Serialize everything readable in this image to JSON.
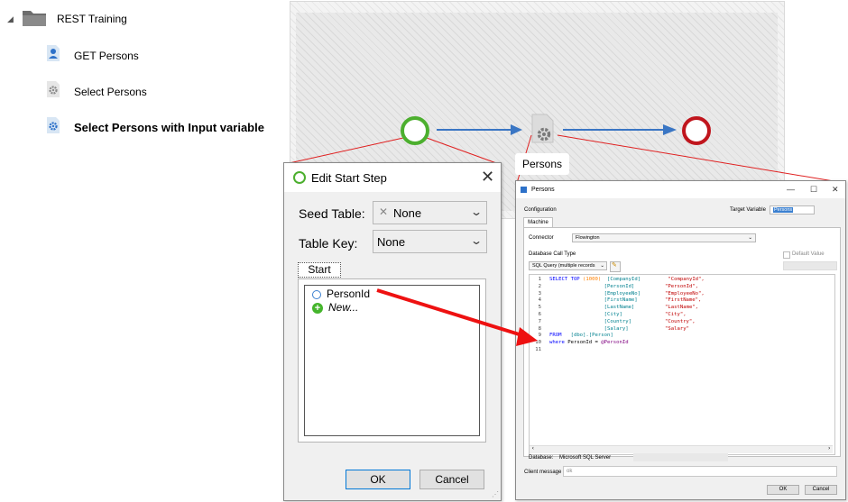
{
  "tree": {
    "root_label": "REST Training",
    "items": [
      {
        "label": "GET Persons",
        "icon": "person-icon"
      },
      {
        "label": "Select Persons",
        "icon": "gear-doc-icon"
      },
      {
        "label": "Select Persons with Input variable",
        "icon": "gear-blue-icon",
        "selected": true
      }
    ]
  },
  "canvas": {
    "step_label": "Persons",
    "colors": {
      "start": "#4caf2e",
      "end": "#c0151d",
      "arrow": "#3a76c4",
      "callout_line": "#e02020"
    }
  },
  "start_dialog": {
    "title": "Edit Start Step",
    "close": "✕",
    "seed_table_label": "Seed Table:",
    "seed_table_value": "None",
    "table_key_label": "Table Key:",
    "table_key_value": "None",
    "tab_label": "Start",
    "variables": [
      {
        "name": "PersonId"
      }
    ],
    "new_label": "New...",
    "ok": "OK",
    "cancel": "Cancel"
  },
  "persons_dialog": {
    "title": "Persons",
    "configuration_label": "Configuration",
    "target_variable_label": "Target Variable",
    "target_variable_value": "Persons",
    "machine_tab": "Machine",
    "connector_label": "Connector",
    "connector_value": "Flowington",
    "default_value_label": "Default Value",
    "db_call_type_label": "Database Call Type",
    "db_call_type_value": "SQL Query (multiple records",
    "code_lines": [
      {
        "n": "1",
        "t": [
          [
            "kw",
            "SELECT TOP "
          ],
          [
            "num",
            "(1000)"
          ],
          [
            "txt",
            "  "
          ],
          [
            "col",
            "[CompanyId]"
          ],
          [
            "txt",
            "         "
          ],
          [
            "str",
            "\"CompanyId\","
          ]
        ]
      },
      {
        "n": "2",
        "t": [
          [
            "txt",
            "                  "
          ],
          [
            "col",
            "[PersonId]"
          ],
          [
            "txt",
            "          "
          ],
          [
            "str",
            "\"PersonId\","
          ]
        ]
      },
      {
        "n": "3",
        "t": [
          [
            "txt",
            "                  "
          ],
          [
            "col",
            "[EmployeeNo]"
          ],
          [
            "txt",
            "        "
          ],
          [
            "str",
            "\"EmployeeNo\","
          ]
        ]
      },
      {
        "n": "4",
        "t": [
          [
            "txt",
            "                  "
          ],
          [
            "col",
            "[FirstName]"
          ],
          [
            "txt",
            "         "
          ],
          [
            "str",
            "\"FirstName\","
          ]
        ]
      },
      {
        "n": "5",
        "t": [
          [
            "txt",
            "                  "
          ],
          [
            "col",
            "[LastName]"
          ],
          [
            "txt",
            "          "
          ],
          [
            "str",
            "\"LastName\","
          ]
        ]
      },
      {
        "n": "6",
        "t": [
          [
            "txt",
            "                  "
          ],
          [
            "col",
            "[City]"
          ],
          [
            "txt",
            "              "
          ],
          [
            "str",
            "\"City\","
          ]
        ]
      },
      {
        "n": "7",
        "t": [
          [
            "txt",
            "                  "
          ],
          [
            "col",
            "[Country]"
          ],
          [
            "txt",
            "           "
          ],
          [
            "str",
            "\"Country\","
          ]
        ]
      },
      {
        "n": "8",
        "t": [
          [
            "txt",
            "                  "
          ],
          [
            "col",
            "[Salary]"
          ],
          [
            "txt",
            "            "
          ],
          [
            "str",
            "\"Salary\""
          ]
        ]
      },
      {
        "n": "9",
        "t": [
          [
            "kw",
            "FROM   "
          ],
          [
            "col",
            "[dbo].[Person]"
          ]
        ]
      },
      {
        "n": "10",
        "t": [
          [
            "kw",
            "where "
          ],
          [
            "txt",
            "PersonId = "
          ],
          [
            "vr",
            "@PersonId"
          ]
        ]
      },
      {
        "n": "11",
        "t": []
      }
    ],
    "database_label": "Database:",
    "database_value": "Microsoft SQL Server",
    "client_message_label": "Client message",
    "client_message_value": "ok",
    "ok": "OK",
    "cancel": "Cancel"
  }
}
